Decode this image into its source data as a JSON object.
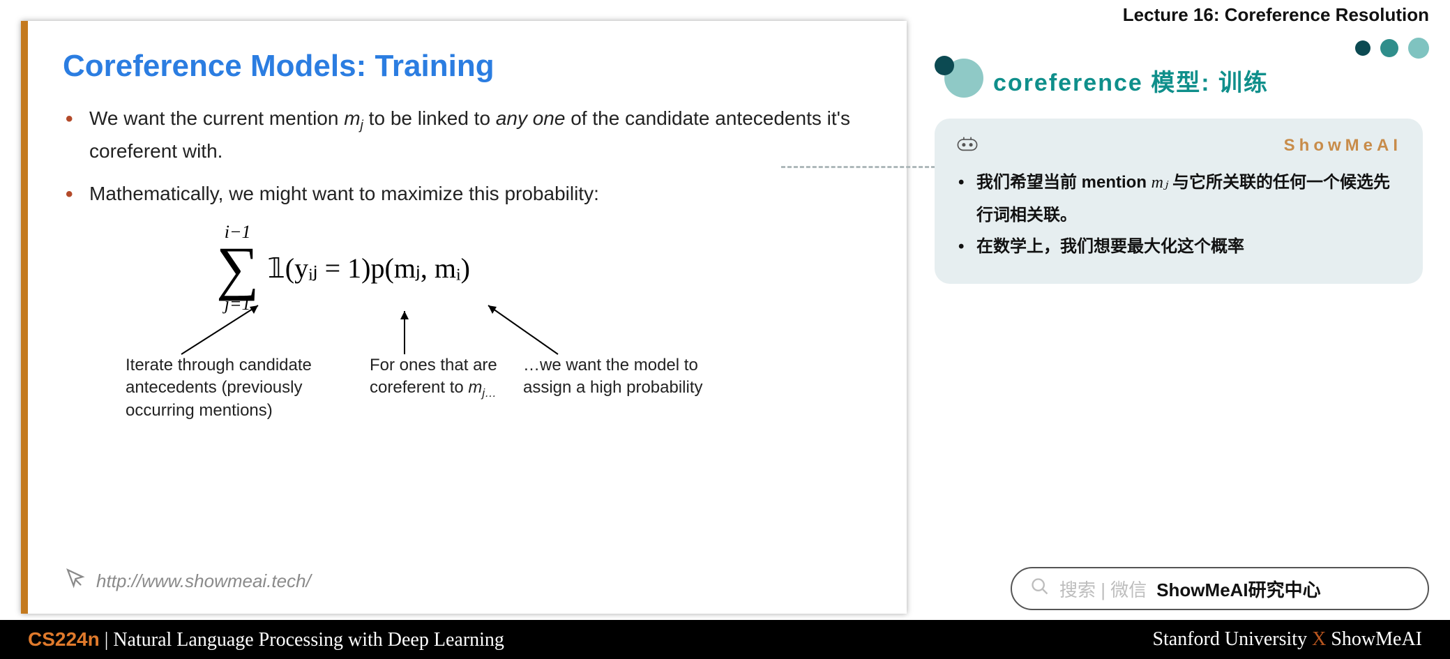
{
  "lecture_header": "Lecture 16: Coreference Resolution",
  "slide": {
    "title": "Coreference Models: Training",
    "bullet1_a": "We want the current mention ",
    "bullet1_mj": "m",
    "bullet1_mjsub": "j",
    "bullet1_b": " to be linked to ",
    "bullet1_any": "any one",
    "bullet1_c": " of the candidate antecedents it's coreferent with.",
    "bullet2": "Mathematically, we might want to maximize this probability:",
    "sum_top": "i−1",
    "sum_bottom": "j=1",
    "formula_body": "𝟙(yᵢⱼ = 1)p(mⱼ, mᵢ)",
    "ann1": "Iterate through candidate antecedents (previously occurring mentions)",
    "ann2_a": "For ones that are coreferent to ",
    "ann2_m": "m",
    "ann2_sub": "j…",
    "ann3": "…we want the model to assign a high probability",
    "footer_url": "http://www.showmeai.tech/"
  },
  "right": {
    "title": "coreference 模型: 训练",
    "brand": "ShowMeAI",
    "cn_bullet1_a": "我们希望当前 mention ",
    "cn_bullet1_mj": "mⱼ",
    "cn_bullet1_b": " 与它所关联的任何一个候选先行词相关联。",
    "cn_bullet2": "在数学上，我们想要最大化这个概率"
  },
  "search": {
    "hint": "搜索 | 微信",
    "strong": "ShowMeAI研究中心"
  },
  "bottom": {
    "course": "CS224n",
    "sep": " | ",
    "subtitle": "Natural Language Processing with Deep Learning",
    "right_a": "Stanford University ",
    "right_x": "X",
    "right_b": " ShowMeAI"
  }
}
